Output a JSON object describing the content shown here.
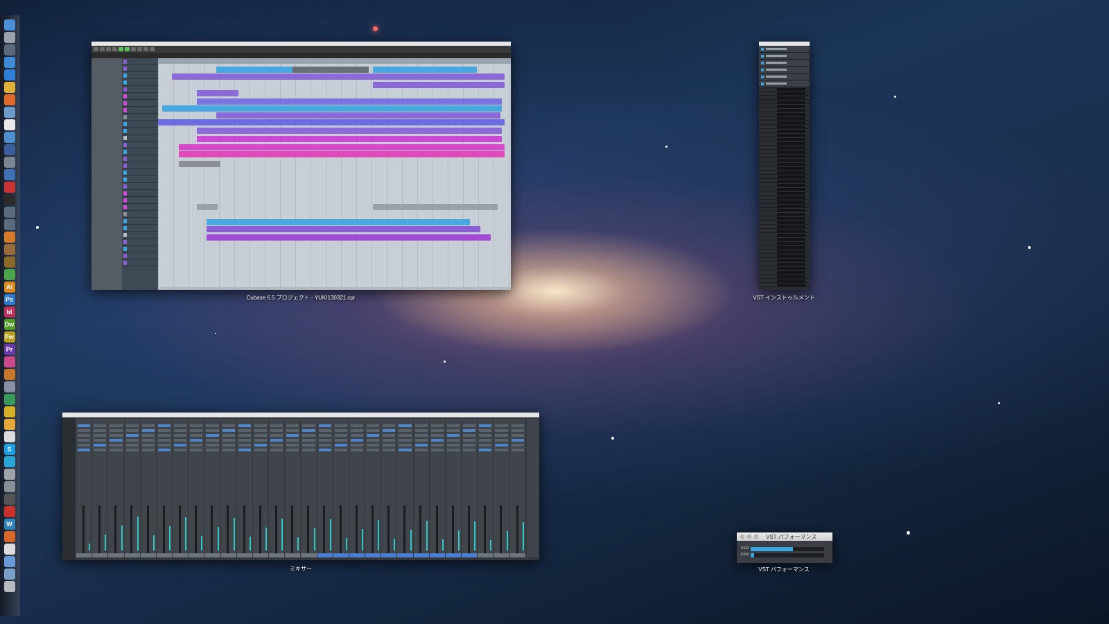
{
  "windows": {
    "project": {
      "label": "Cubase 6.5 プロジェクト - YUKI130321.cpr"
    },
    "vst_instruments": {
      "label": "VST インストゥルメント"
    },
    "mixer": {
      "label": "ミキサー"
    },
    "vst_performance": {
      "label": "VST パフォーマンス",
      "title": "VST パフォーマンス",
      "meters": [
        {
          "name": "ASIO",
          "value": 0.58
        },
        {
          "name": "DISK",
          "value": 0.05
        }
      ]
    }
  },
  "dock": {
    "icons": [
      {
        "name": "finder-icon",
        "glyph": "",
        "color": "#4b8fd6"
      },
      {
        "name": "launchpad-icon",
        "glyph": "",
        "color": "#9aa3ad"
      },
      {
        "name": "mission-control-icon",
        "glyph": "",
        "color": "#5a6a7a"
      },
      {
        "name": "safari-icon",
        "glyph": "",
        "color": "#3f8ad9"
      },
      {
        "name": "app-store-icon",
        "glyph": "",
        "color": "#2f7fd8"
      },
      {
        "name": "chrome-icon",
        "glyph": "",
        "color": "#e0b13a"
      },
      {
        "name": "firefox-icon",
        "glyph": "",
        "color": "#e06a2a"
      },
      {
        "name": "preview-icon",
        "glyph": "",
        "color": "#6e9ac9"
      },
      {
        "name": "calendar-icon",
        "glyph": "",
        "color": "#e9e9e9"
      },
      {
        "name": "mail-icon",
        "glyph": "",
        "color": "#4d8ecc"
      },
      {
        "name": "xcode-icon",
        "glyph": "",
        "color": "#3b5f9a"
      },
      {
        "name": "utility-icon",
        "glyph": "",
        "color": "#7a8592"
      },
      {
        "name": "network-icon",
        "glyph": "",
        "color": "#3e70b5"
      },
      {
        "name": "filezilla-icon",
        "glyph": "",
        "color": "#c83232"
      },
      {
        "name": "clock-icon",
        "glyph": "",
        "color": "#2b2b2b"
      },
      {
        "name": "cubase-icon",
        "glyph": "",
        "color": "#5b6c7f"
      },
      {
        "name": "cubase-alt-icon",
        "glyph": "",
        "color": "#5b6c7f"
      },
      {
        "name": "logic-icon",
        "glyph": "",
        "color": "#d57a2a"
      },
      {
        "name": "image-tool-icon",
        "glyph": "",
        "color": "#9a6b3a"
      },
      {
        "name": "guitar-icon",
        "glyph": "",
        "color": "#8a6a2a"
      },
      {
        "name": "pencil-icon",
        "glyph": "",
        "color": "#4ba34b"
      },
      {
        "name": "illustrator-icon",
        "glyph": "Ai",
        "color": "#d9891e"
      },
      {
        "name": "photoshop-icon",
        "glyph": "Ps",
        "color": "#2f77c8"
      },
      {
        "name": "indesign-icon",
        "glyph": "Id",
        "color": "#b8325c"
      },
      {
        "name": "dreamweaver-icon",
        "glyph": "Dw",
        "color": "#4f9a2a"
      },
      {
        "name": "fireworks-icon",
        "glyph": "Fw",
        "color": "#b8a022"
      },
      {
        "name": "premiere-icon",
        "glyph": "Pr",
        "color": "#6a3aa6"
      },
      {
        "name": "flower-app-icon",
        "glyph": "",
        "color": "#c84a8a"
      },
      {
        "name": "toolbox-icon",
        "glyph": "",
        "color": "#c8762a"
      },
      {
        "name": "brush-icon",
        "glyph": "",
        "color": "#8a8fa6"
      },
      {
        "name": "chart-app-icon",
        "glyph": "",
        "color": "#3a9a5a"
      },
      {
        "name": "game-icon",
        "glyph": "",
        "color": "#d6b12a"
      },
      {
        "name": "folder-icon",
        "glyph": "",
        "color": "#e6a73a"
      },
      {
        "name": "keyboard-icon",
        "glyph": "",
        "color": "#dcdcdc"
      },
      {
        "name": "skype-icon",
        "glyph": "S",
        "color": "#1ea0e6"
      },
      {
        "name": "messenger-icon",
        "glyph": "",
        "color": "#2aa6d6"
      },
      {
        "name": "printer-icon",
        "glyph": "",
        "color": "#a0a4a8"
      },
      {
        "name": "system-preferences-icon",
        "glyph": "",
        "color": "#8a8f96"
      },
      {
        "name": "terminal-icon",
        "glyph": "",
        "color": "#555"
      },
      {
        "name": "record-icon",
        "glyph": "",
        "color": "#c8322a"
      },
      {
        "name": "wordpress-icon",
        "glyph": "W",
        "color": "#2f7fb8"
      },
      {
        "name": "photo-icon",
        "glyph": "",
        "color": "#d6672a"
      },
      {
        "name": "warning-app-icon",
        "glyph": "",
        "color": "#dcdcdc"
      },
      {
        "name": "documents-folder-icon",
        "glyph": "",
        "color": "#6a9ad6"
      },
      {
        "name": "music-folder-icon",
        "glyph": "",
        "color": "#7aa0c8"
      },
      {
        "name": "trash-icon",
        "glyph": "",
        "color": "#b8bcc2"
      }
    ]
  }
}
